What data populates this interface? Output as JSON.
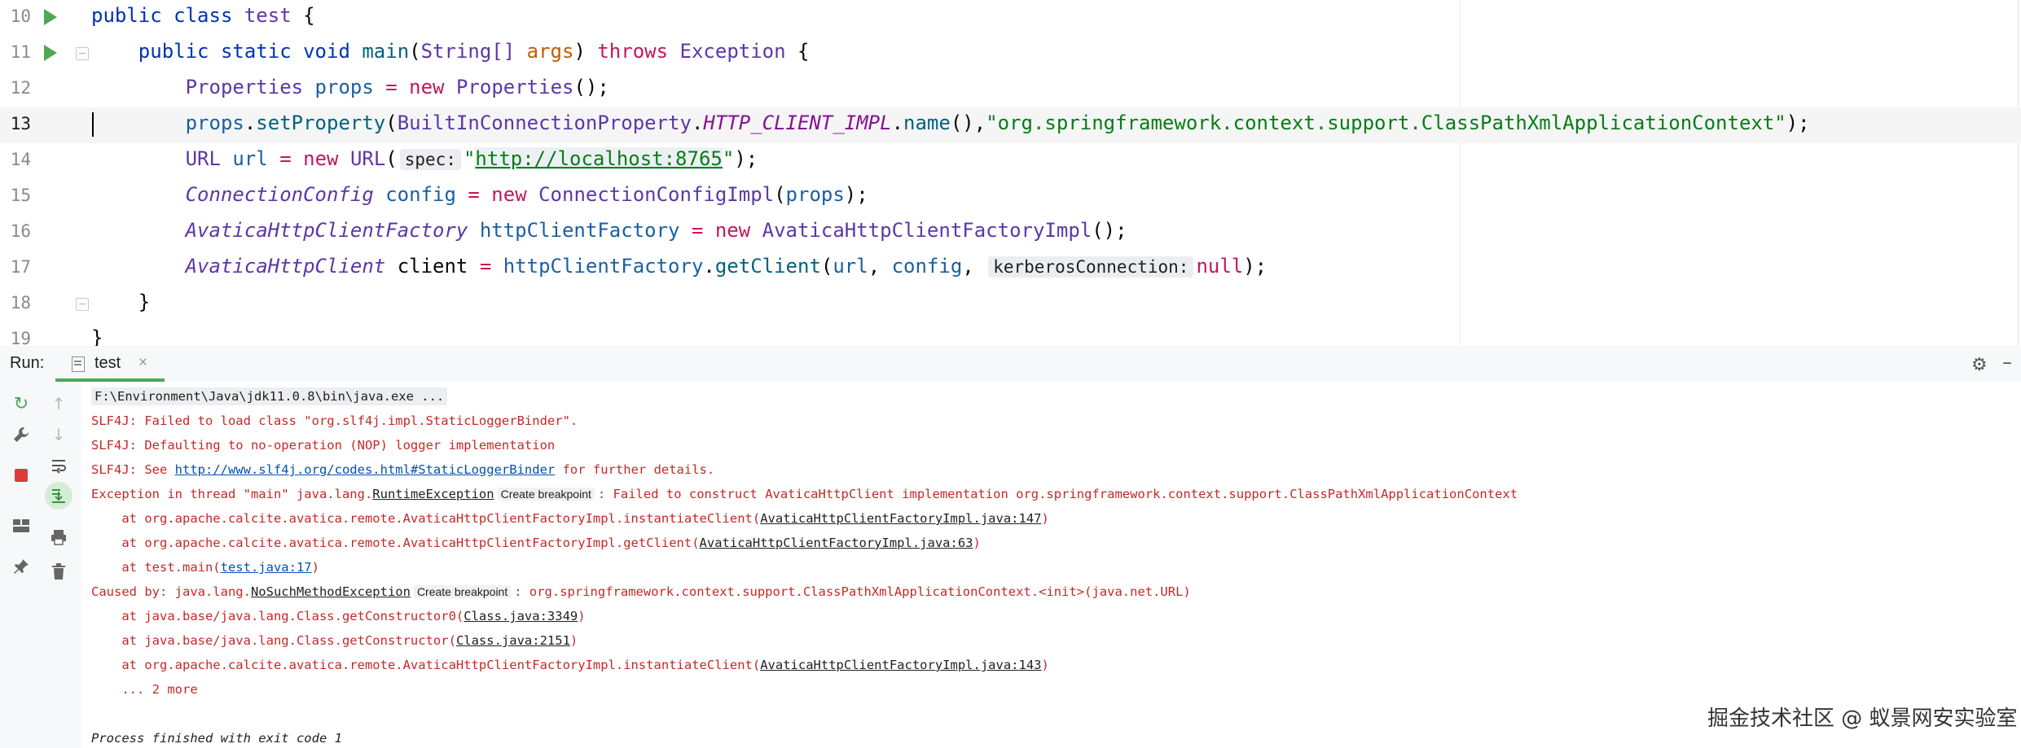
{
  "editor": {
    "lines": [
      {
        "num": "10"
      },
      {
        "num": "11"
      },
      {
        "num": "12"
      },
      {
        "num": "13"
      },
      {
        "num": "14"
      },
      {
        "num": "15"
      },
      {
        "num": "16"
      },
      {
        "num": "17"
      },
      {
        "num": "18"
      },
      {
        "num": "19"
      }
    ],
    "tokens": {
      "public": "public",
      "class": "class",
      "test": "test",
      "static": "static",
      "void": "void",
      "main": "main",
      "string_arr": "String[]",
      "args": "args",
      "throws": "throws",
      "exception": "Exception",
      "properties": "Properties",
      "props": "props",
      "new": "new",
      "setProperty": "setProperty",
      "builtin": "BuiltInConnectionProperty",
      "http_impl": "HTTP_CLIENT_IMPL",
      "name": "name",
      "impl_string": "\"org.springframework.context.support.ClassPathXmlApplicationContext\"",
      "url_type": "URL",
      "url_var": "url",
      "spec_hint": "spec:",
      "url_value": "http://localhost:8765",
      "connconfig": "ConnectionConfig",
      "config": "config",
      "connconfigimpl": "ConnectionConfigImpl",
      "factory_type": "AvaticaHttpClientFactory",
      "factory_var": "httpClientFactory",
      "factory_impl": "AvaticaHttpClientFactoryImpl",
      "client_type": "AvaticaHttpClient",
      "client_var": "client",
      "getClient": "getClient",
      "kerberos_hint": "kerberosConnection:",
      "null": "null"
    }
  },
  "run_panel": {
    "label": "Run:",
    "tab_label": "test",
    "tab_close": "×"
  },
  "console": {
    "cmd": "F:\\Environment\\Java\\jdk11.0.8\\bin\\java.exe ...",
    "slf1": "SLF4J: Failed to load class \"org.slf4j.impl.StaticLoggerBinder\".",
    "slf2": "SLF4J: Defaulting to no-operation (NOP) logger implementation",
    "slf3_pre": "SLF4J: See ",
    "slf3_link": "http://www.slf4j.org/codes.html#StaticLoggerBinder",
    "slf3_post": " for further details.",
    "exc_pre": "Exception in thread \"main\" java.lang.",
    "exc_name": "RuntimeException",
    "create_bp": "Create breakpoint",
    "exc_post": ": Failed to construct AvaticaHttpClient implementation org.springframework.context.support.ClassPathXmlApplicationContext",
    "st1_pre": "    at org.apache.calcite.avatica.remote.AvaticaHttpClientFactoryImpl.instantiateClient(",
    "st1_link": "AvaticaHttpClientFactoryImpl.java:147",
    "st2_pre": "    at org.apache.calcite.avatica.remote.AvaticaHttpClientFactoryImpl.getClient(",
    "st2_link": "AvaticaHttpClientFactoryImpl.java:63",
    "st3_pre": "    at test.main(",
    "st3_link": "test.java:17",
    "close_paren": ")",
    "caused_pre": "Caused by: java.lang.",
    "caused_name": "NoSuchMethodException",
    "caused_post": ": org.springframework.context.support.ClassPathXmlApplicationContext.<init>(java.net.URL)",
    "st4_pre": "    at java.base/java.lang.Class.getConstructor0(",
    "st4_link": "Class.java:3349",
    "st5_pre": "    at java.base/java.lang.Class.getConstructor(",
    "st5_link": "Class.java:2151",
    "st6_pre": "    at org.apache.calcite.avatica.remote.AvaticaHttpClientFactoryImpl.instantiateClient(",
    "st6_link": "AvaticaHttpClientFactoryImpl.java:143",
    "more": "    ... 2 more",
    "finished": "Process finished with exit code 1"
  },
  "watermark": "掘金技术社区 @ 蚁景网安实验室",
  "colors": {
    "run_green": "#4fa854",
    "error_red": "#c62828",
    "keyword_blue": "#0033b3",
    "link_blue": "#0550ae"
  }
}
